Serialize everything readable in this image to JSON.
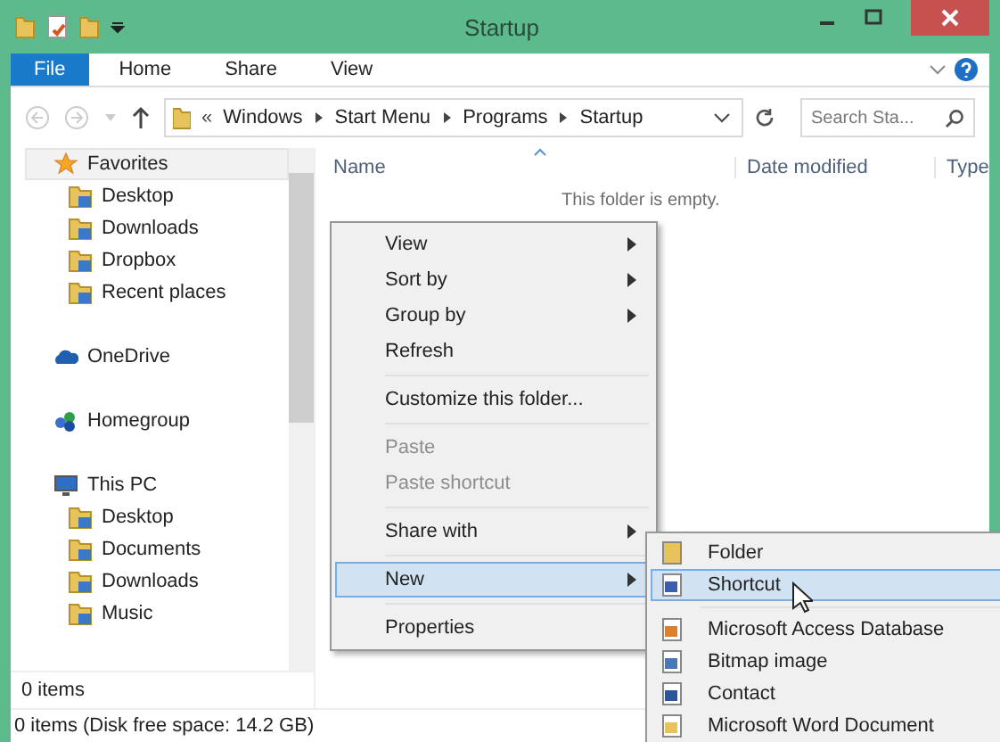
{
  "window": {
    "title": "Startup"
  },
  "ribbon": {
    "tabs": [
      {
        "label": "File",
        "selected": true
      },
      {
        "label": "Home",
        "selected": false
      },
      {
        "label": "Share",
        "selected": false
      },
      {
        "label": "View",
        "selected": false
      }
    ]
  },
  "address": {
    "path": [
      "Windows",
      "Start Menu",
      "Programs",
      "Startup"
    ],
    "overflow": "«",
    "search_placeholder": "Search Sta..."
  },
  "sidebar": {
    "items": [
      {
        "label": "Favorites",
        "selected": true,
        "children": [
          {
            "label": "Desktop",
            "selected": false
          },
          {
            "label": "Downloads",
            "selected": false
          },
          {
            "label": "Dropbox",
            "selected": false
          },
          {
            "label": "Recent places",
            "selected": false
          }
        ]
      },
      {
        "label": "OneDrive",
        "selected": false
      },
      {
        "label": "Homegroup",
        "selected": false
      },
      {
        "label": "This PC",
        "selected": false,
        "children": [
          {
            "label": "Desktop",
            "selected": false
          },
          {
            "label": "Documents",
            "selected": false
          },
          {
            "label": "Downloads",
            "selected": false
          },
          {
            "label": "Music",
            "selected": false
          }
        ]
      }
    ]
  },
  "table": {
    "columns": [
      "Name",
      "Date modified",
      "Type"
    ],
    "empty_message": "This folder is empty."
  },
  "context_menu": {
    "items": [
      {
        "kind": "item",
        "label": "View",
        "submenu": true,
        "disabled": false,
        "selected": false
      },
      {
        "kind": "item",
        "label": "Sort by",
        "submenu": true,
        "disabled": false,
        "selected": false
      },
      {
        "kind": "item",
        "label": "Group by",
        "submenu": true,
        "disabled": false,
        "selected": false
      },
      {
        "kind": "item",
        "label": "Refresh",
        "submenu": false,
        "disabled": false,
        "selected": false
      },
      {
        "kind": "separator"
      },
      {
        "kind": "item",
        "label": "Customize this folder...",
        "submenu": false,
        "disabled": false,
        "selected": false
      },
      {
        "kind": "separator"
      },
      {
        "kind": "item",
        "label": "Paste",
        "submenu": false,
        "disabled": true,
        "selected": false
      },
      {
        "kind": "item",
        "label": "Paste shortcut",
        "submenu": false,
        "disabled": true,
        "selected": false
      },
      {
        "kind": "separator"
      },
      {
        "kind": "item",
        "label": "Share with",
        "submenu": true,
        "disabled": false,
        "selected": false
      },
      {
        "kind": "separator"
      },
      {
        "kind": "item",
        "label": "New",
        "submenu": true,
        "disabled": false,
        "selected": true
      },
      {
        "kind": "separator"
      },
      {
        "kind": "item",
        "label": "Properties",
        "submenu": false,
        "disabled": false,
        "selected": false
      }
    ]
  },
  "new_submenu": {
    "items": [
      {
        "kind": "item",
        "label": "Folder",
        "selected": false
      },
      {
        "kind": "item",
        "label": "Shortcut",
        "selected": true
      },
      {
        "kind": "separator"
      },
      {
        "kind": "item",
        "label": "Microsoft Access Database",
        "selected": false
      },
      {
        "kind": "item",
        "label": "Bitmap image",
        "selected": false
      },
      {
        "kind": "item",
        "label": "Contact",
        "selected": false
      },
      {
        "kind": "item",
        "label": "Microsoft Word Document",
        "selected": false
      }
    ]
  },
  "sidebar_status": "0 items",
  "status_bar": "0 items (Disk free space: 14.2 GB)"
}
